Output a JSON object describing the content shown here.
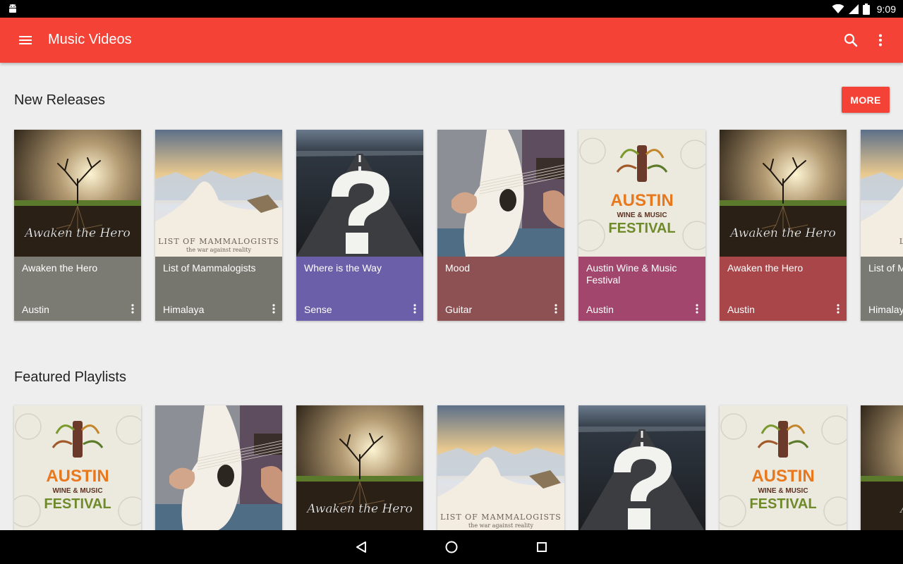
{
  "status_bar": {
    "time": "9:09",
    "icons": [
      "android-icon",
      "wifi-icon",
      "signal-icon",
      "battery-icon"
    ]
  },
  "app_bar": {
    "title": "Music Videos",
    "icons": [
      "menu-icon",
      "search-icon",
      "overflow-icon"
    ],
    "color": "#f44336"
  },
  "new_releases": {
    "title": "New Releases",
    "more_label": "MORE",
    "cards": [
      {
        "title": "Awaken the Hero",
        "subtitle": "Austin",
        "art_title": "Awaken the Hero",
        "color": "#7b7b74",
        "art": "hero"
      },
      {
        "title": "List of Mammalogists",
        "subtitle": "Himalaya",
        "art_title": "List of Mammalogists",
        "art_subtitle": "the war against reality",
        "color": "#76766f",
        "art": "snow"
      },
      {
        "title": "Where is the Way",
        "subtitle": "Sense",
        "color": "#6a5fa8",
        "art": "road"
      },
      {
        "title": "Mood",
        "subtitle": "Guitar",
        "color": "#8e5153",
        "art": "guitar"
      },
      {
        "title": "Austin Wine & Music Festival",
        "subtitle": "Austin",
        "art_title": "AUSTIN",
        "art_mid": "WINE & MUSIC",
        "art_bottom": "FESTIVAL",
        "color": "#a2466d",
        "art": "festival"
      },
      {
        "title": "Awaken the Hero",
        "subtitle": "Austin",
        "art_title": "Awaken the Hero",
        "color": "#a8464a",
        "art": "hero"
      },
      {
        "title": "List of M",
        "subtitle": "Himalay",
        "art_title": "List of M",
        "art_subtitle": "the",
        "color": "#7a7a74",
        "art": "snow"
      }
    ]
  },
  "featured_playlists": {
    "title": "Featured Playlists",
    "cards": [
      {
        "art": "festival",
        "art_title": "AUSTIN",
        "art_mid": "WINE & MUSIC",
        "art_bottom": "FESTIVAL"
      },
      {
        "art": "guitar"
      },
      {
        "art": "hero",
        "art_title": "Awaken the Hero"
      },
      {
        "art": "snow",
        "art_title": "List of Mammalogists",
        "art_subtitle": "the war against reality"
      },
      {
        "art": "road"
      },
      {
        "art": "festival",
        "art_title": "AUSTIN",
        "art_mid": "WINE & MUSIC",
        "art_bottom": "FESTIVAL"
      },
      {
        "art": "hero",
        "art_title": "Awaken"
      }
    ]
  },
  "nav_bar": {
    "icons": [
      "back-icon",
      "home-icon",
      "recents-icon"
    ]
  }
}
